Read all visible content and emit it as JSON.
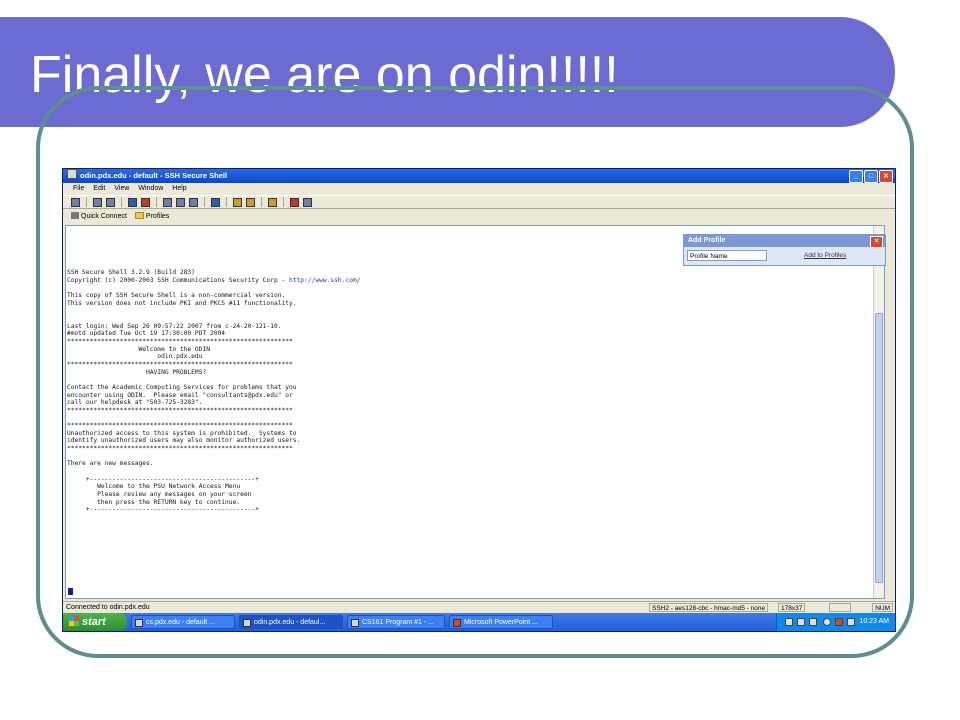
{
  "slide": {
    "title": "Finally, we are on odin!!!!!"
  },
  "window": {
    "title": "odin.pdx.edu - default - SSH Secure Shell",
    "menu": [
      "File",
      "Edit",
      "View",
      "Window",
      "Help"
    ],
    "quick_connect": "Quick Connect",
    "profiles": "Profiles"
  },
  "add_profile": {
    "title": "Add Profile",
    "input_value": "Profile Name",
    "add_link": "Add to Profiles"
  },
  "terminal": {
    "lines": [
      "SSH Secure Shell 3.2.9 (Build 283)",
      "Copyright (c) 2000-2003 SSH Communications Security Corp - ",
      "",
      "This copy of SSH Secure Shell is a non-commercial version.",
      "This version does not include PKI and PKCS #11 functionality.",
      "",
      "",
      "Last login: Wed Sep 26 09:57:22 2007 from c-24-20-121-10.",
      "#motd updated Tue Oct 19 17:30:00 PDT 2004",
      "************************************************************",
      "                   Welcome to the ODIN",
      "                        odin.pdx.edu",
      "************************************************************",
      "                     HAVING PROBLEMS?",
      "",
      "Contact the Academic Computing Services for problems that you",
      "encounter using ODIN.  Please email \"consultants@pdx.edu\" or",
      "call our helpdesk at \"503-725-3283\".",
      "************************************************************",
      "",
      "************************************************************",
      "Unauthorized access to this system is prohibited.  Systems to",
      "identify unauthorized users may also monitor authorized users.",
      "************************************************************",
      "",
      "There are new messages.",
      "",
      "     +--------------------------------------------+",
      "        Welcome to the PSU Network Access Menu",
      "        Please review any messages on your screen",
      "        then press the RETURN key to continue.",
      "     +--------------------------------------------+"
    ],
    "url": "http://www.ssh.com/"
  },
  "statusbar": {
    "connected": "Connected to odin.pdx.edu",
    "cipher": "SSH2 - aes128-cbc - hmac-md5 - none",
    "size": "178x37",
    "num": "NUM"
  },
  "taskbar": {
    "start": "start",
    "tasks": [
      "cs.pdx.edu - default ...",
      "odin.pdx.edu - defaul...",
      "CS161 Program #1 - ...",
      "Microsoft PowerPoint ..."
    ],
    "clock": "10:23 AM"
  }
}
